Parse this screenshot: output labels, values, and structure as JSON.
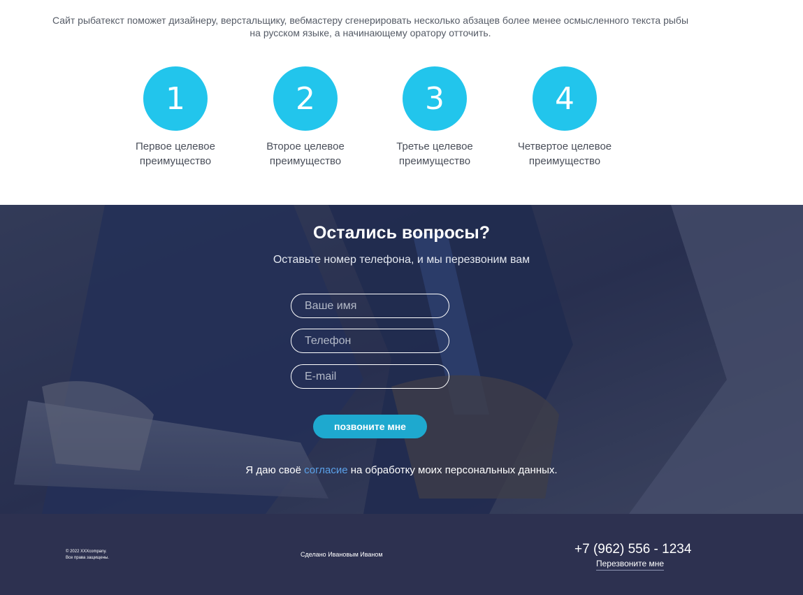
{
  "intro": {
    "line1": "Сайт рыбатекст поможет дизайнеру, верстальщику, вебмастеру сгенерировать несколько абзацев более менее осмысленного текста рыбы",
    "line2": "на русском языке, а начинающему оратору отточить."
  },
  "features": [
    {
      "number": "1",
      "line1": "Первое целевое",
      "line2": "преимущество"
    },
    {
      "number": "2",
      "line1": "Второе целевое",
      "line2": "преимущество"
    },
    {
      "number": "3",
      "line1": "Третье целевое",
      "line2": "преимущество"
    },
    {
      "number": "4",
      "line1": "Четвертое целевое",
      "line2": "преимущество"
    }
  ],
  "contact": {
    "title": "Остались вопросы?",
    "subtitle": "Оставьте номер телефона, и мы перезвоним вам",
    "name_placeholder": "Ваше имя",
    "phone_placeholder": "Телефон",
    "email_placeholder": "E-mail",
    "button_label": "позвоните мне",
    "consent_before": "Я даю своё",
    "consent_link": "согласие",
    "consent_after": "на обработку моих персональных данных."
  },
  "footer": {
    "copyright_line1": "© 2022 XXXcompany.",
    "copyright_line2": "Все права защищены.",
    "made_by": "Сделано Ивановым Иваном",
    "phone": "+7 (962) 556 - 1234",
    "callback_link": "Перезвоните мне"
  },
  "colors": {
    "accent": "#22c5ec",
    "button": "#1ea9cf",
    "footer_bg": "#2d3150",
    "link": "#5aa0e8"
  }
}
